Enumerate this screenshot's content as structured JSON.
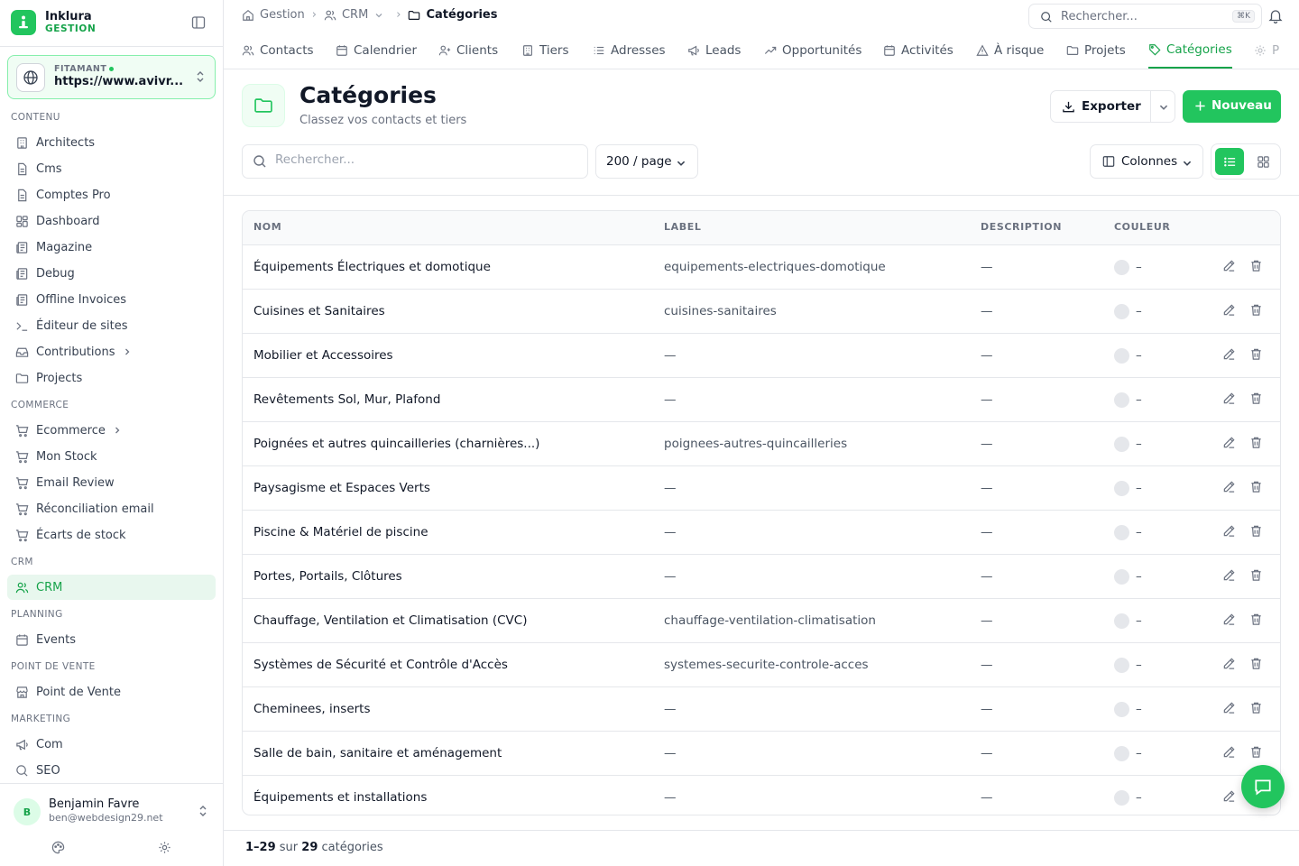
{
  "brand": {
    "name": "Inklura",
    "sub": "GESTION"
  },
  "site": {
    "label": "FITAMANT",
    "url": "https://www.avivr..."
  },
  "sidebar": {
    "sections": [
      {
        "title": "CONTENU",
        "items": [
          {
            "label": "Architects",
            "icon": "building-icon"
          },
          {
            "label": "Cms",
            "icon": "file-icon"
          },
          {
            "label": "Comptes Pro",
            "icon": "file-icon"
          },
          {
            "label": "Dashboard",
            "icon": "dashboard-icon"
          },
          {
            "label": "Magazine",
            "icon": "newspaper-icon"
          },
          {
            "label": "Debug",
            "icon": "newspaper-icon"
          },
          {
            "label": "Offline Invoices",
            "icon": "newspaper-icon"
          },
          {
            "label": "Éditeur de sites",
            "icon": "terminal-icon"
          },
          {
            "label": "Contributions",
            "icon": "inbox-icon",
            "arrow": true
          },
          {
            "label": "Projects",
            "icon": "folder-icon"
          }
        ]
      },
      {
        "title": "COMMERCE",
        "items": [
          {
            "label": "Ecommerce",
            "icon": "cart-icon",
            "arrow": true
          },
          {
            "label": "Mon Stock",
            "icon": "cart-icon"
          },
          {
            "label": "Email Review",
            "icon": "cart-icon"
          },
          {
            "label": "Réconciliation email",
            "icon": "cart-icon"
          },
          {
            "label": "Écarts de stock",
            "icon": "cart-icon"
          }
        ]
      },
      {
        "title": "CRM",
        "items": [
          {
            "label": "CRM",
            "icon": "users-icon",
            "active": true
          }
        ]
      },
      {
        "title": "PLANNING",
        "items": [
          {
            "label": "Events",
            "icon": "calendar-icon"
          }
        ]
      },
      {
        "title": "POINT DE VENTE",
        "items": [
          {
            "label": "Point de Vente",
            "icon": "store-icon"
          }
        ]
      },
      {
        "title": "MARKETING",
        "items": [
          {
            "label": "Com",
            "icon": "megaphone-icon"
          },
          {
            "label": "SEO",
            "icon": "search-icon"
          }
        ]
      }
    ]
  },
  "user": {
    "initial": "B",
    "name": "Benjamin Favre",
    "email": "ben@webdesign29.net"
  },
  "breadcrumb": {
    "home": "Gestion",
    "crm": "CRM",
    "current": "Catégories"
  },
  "topsearch": {
    "placeholder": "Rechercher...",
    "shortcut": "⌘K"
  },
  "tabs": [
    {
      "label": "Contacts",
      "icon": "users-icon"
    },
    {
      "label": "Calendrier",
      "icon": "calendar-icon"
    },
    {
      "label": "Clients",
      "icon": "user-plus-icon"
    },
    {
      "label": "Tiers",
      "icon": "building-icon"
    },
    {
      "label": "Adresses",
      "icon": "list-icon"
    },
    {
      "label": "Leads",
      "icon": "megaphone-icon"
    },
    {
      "label": "Opportunités",
      "icon": "trending-icon"
    },
    {
      "label": "Activités",
      "icon": "calendar-icon"
    },
    {
      "label": "À risque",
      "icon": "alert-icon"
    },
    {
      "label": "Projets",
      "icon": "folder-icon"
    },
    {
      "label": "Catégories",
      "icon": "tag-icon",
      "active": true
    },
    {
      "label": "P",
      "icon": "gear-icon"
    }
  ],
  "page": {
    "title": "Catégories",
    "subtitle": "Classez vos contacts et tiers"
  },
  "actions": {
    "export": "Exporter",
    "new": "Nouveau"
  },
  "toolbar": {
    "search_placeholder": "Rechercher...",
    "per_page": "200 / page",
    "columns": "Colonnes"
  },
  "table": {
    "headers": {
      "nom": "NOM",
      "label": "LABEL",
      "description": "DESCRIPTION",
      "couleur": "COULEUR"
    },
    "rows": [
      {
        "nom": "Équipements Électriques et domotique",
        "label": "equipements-electriques-domotique",
        "description": "—",
        "couleur": "–"
      },
      {
        "nom": "Cuisines et Sanitaires",
        "label": "cuisines-sanitaires",
        "description": "—",
        "couleur": "–"
      },
      {
        "nom": "Mobilier et Accessoires",
        "label": "—",
        "description": "—",
        "couleur": "–"
      },
      {
        "nom": "Revêtements Sol, Mur, Plafond",
        "label": "—",
        "description": "—",
        "couleur": "–"
      },
      {
        "nom": "Poignées et autres quincailleries (charnières...)",
        "label": "poignees-autres-quincailleries",
        "description": "—",
        "couleur": "–"
      },
      {
        "nom": "Paysagisme et Espaces Verts",
        "label": "—",
        "description": "—",
        "couleur": "–"
      },
      {
        "nom": "Piscine & Matériel de piscine",
        "label": "—",
        "description": "—",
        "couleur": "–"
      },
      {
        "nom": "Portes, Portails, Clôtures",
        "label": "—",
        "description": "—",
        "couleur": "–"
      },
      {
        "nom": "Chauffage, Ventilation et Climatisation (CVC)",
        "label": "chauffage-ventilation-climatisation",
        "description": "—",
        "couleur": "–"
      },
      {
        "nom": "Systèmes de Sécurité et Contrôle d'Accès",
        "label": "systemes-securite-controle-acces",
        "description": "—",
        "couleur": "–"
      },
      {
        "nom": "Cheminees, inserts",
        "label": "—",
        "description": "—",
        "couleur": "–"
      },
      {
        "nom": "Salle de bain, sanitaire et aménagement",
        "label": "—",
        "description": "—",
        "couleur": "–"
      },
      {
        "nom": "Équipements et installations",
        "label": "—",
        "description": "—",
        "couleur": "–"
      }
    ]
  },
  "footer": {
    "range": "1–29",
    "sur": "sur",
    "total": "29",
    "unit": "catégories"
  },
  "colors": {
    "accent": "#22c55e",
    "accent_dark": "#16a34a",
    "accent_bg": "#f0fdf4",
    "swatch": "#e5e7eb"
  }
}
